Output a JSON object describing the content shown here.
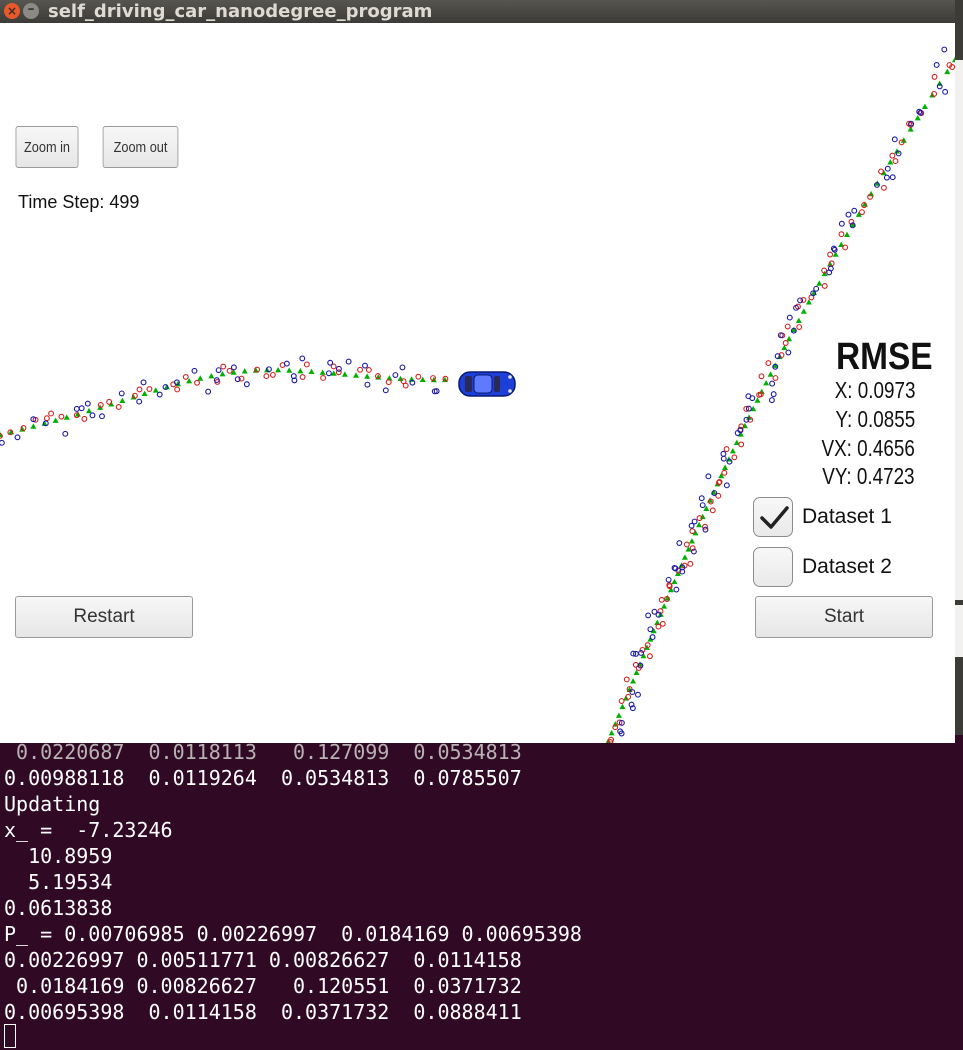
{
  "window": {
    "title": "self_driving_car_nanodegree_program",
    "close_glyph": "×",
    "minimize_glyph": "–"
  },
  "controls": {
    "zoom_in_label": "Zoom in",
    "zoom_out_label": "Zoom out",
    "time_step_label": "Time Step: 499",
    "restart_label": "Restart",
    "start_label": "Start"
  },
  "rmse": {
    "title": "RMSE",
    "x": "X: 0.0973",
    "y": "Y: 0.0855",
    "vx": "VX: 0.4656",
    "vy": "VY: 0.4723"
  },
  "datasets": [
    {
      "label": "Dataset 1",
      "checked": true
    },
    {
      "label": "Dataset 2",
      "checked": false
    }
  ],
  "markers": {
    "ground_truth_color": "#00b000",
    "lidar_color": "#d42020",
    "radar_color": "#1a1aa8",
    "car_color": "#1c3fd8"
  },
  "terminal": {
    "lines": [
      " 0.0220687  0.0118113   0.127099  0.0534813",
      "0.00988118  0.0119264  0.0534813  0.0785507",
      "Updating",
      "x_ =  -7.23246",
      "  10.8959",
      "  5.19534",
      "0.0613838",
      "P_ = 0.00706985 0.00226997  0.0184169 0.00695398",
      "0.00226997 0.00511771 0.00826627  0.0114158",
      " 0.0184169 0.00826627   0.120551  0.0371732",
      "0.00695398  0.0114158  0.0371732  0.0888411"
    ]
  }
}
